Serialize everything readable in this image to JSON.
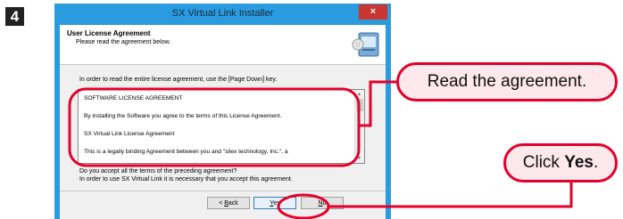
{
  "step": {
    "number": "4"
  },
  "window": {
    "title": "SX Virtual Link Installer",
    "close_glyph": "×"
  },
  "header": {
    "title": "User License Agreement",
    "subtitle": "Please read the agreement below.",
    "icon": "setup-disc-icon"
  },
  "body": {
    "instruction": "In order to read the entire license agreement, use the [Page Down] key.",
    "license_lines": [
      "SOFTWARE LICENSE AGREEMENT",
      "By installing the Software you agree to the terms of this License Agreement.",
      "SX Virtual Link License Agreement",
      "This is a legally binding Agreement between you and \"silex technology, Inc.\", a"
    ],
    "question": "Do you accept all the terms of the preceding agreement?",
    "requirement": "In order to use SX Virtual Link it is necessary that you accept this agreement."
  },
  "buttons": {
    "back_prefix": "< ",
    "back_ul": "B",
    "back_rest": "ack",
    "yes_ul": "Y",
    "yes_rest": "es",
    "no_ul": "N",
    "no_rest": "o"
  },
  "callouts": {
    "read": "Read the agreement.",
    "click_prefix": "Click ",
    "click_bold": "Yes",
    "click_suffix": "."
  },
  "colors": {
    "annotation_red": "#e4002b",
    "callout_fill": "#fde8ec",
    "window_frame": "#2b9be0",
    "close_button": "#c7372f"
  }
}
